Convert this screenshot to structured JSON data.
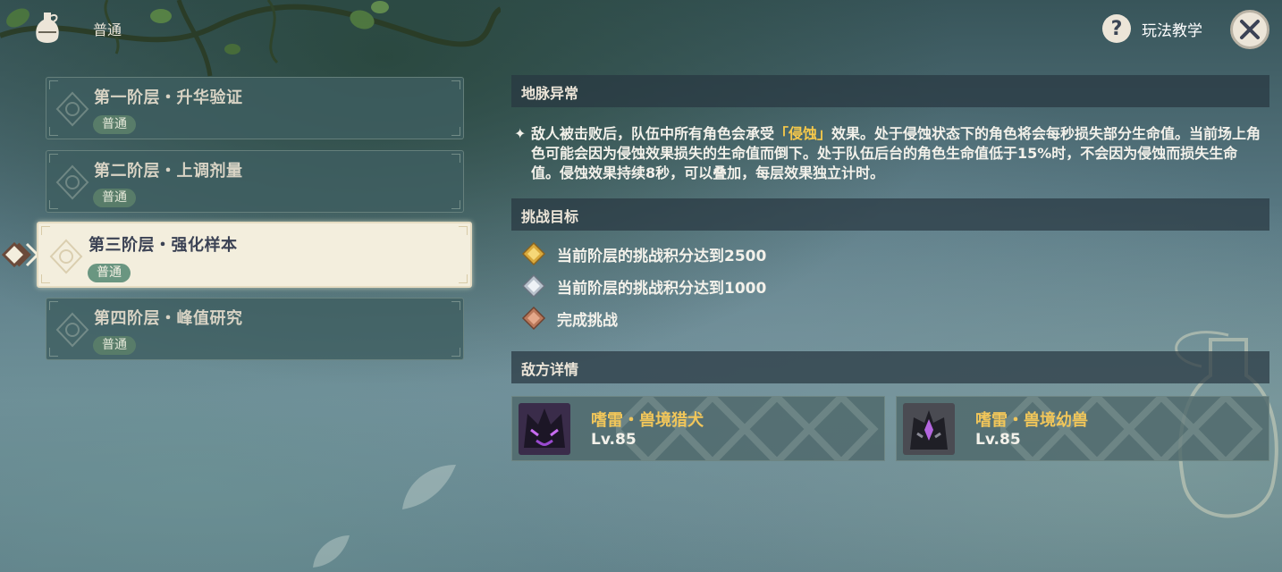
{
  "header": {
    "mode_label": "普通",
    "help_label": "玩法教学"
  },
  "stages": [
    {
      "title": "第一阶层・升华验证",
      "badge": "普通",
      "selected": false
    },
    {
      "title": "第二阶层・上调剂量",
      "badge": "普通",
      "selected": false
    },
    {
      "title": "第三阶层・强化样本",
      "badge": "普通",
      "selected": true
    },
    {
      "title": "第四阶层・峰值研究",
      "badge": "普通",
      "selected": false
    }
  ],
  "ley_line": {
    "header": "地脉异常",
    "star": "✦",
    "text_before": "敌人被击败后，队伍中所有角色会承受",
    "highlight": "「侵蚀」",
    "text_after": "效果。处于侵蚀状态下的角色将会每秒损失部分生命值。当前场上角色可能会因为侵蚀效果损失的生命值而倒下。处于队伍后台的角色生命值低于15%时，不会因为侵蚀而损失生命值。侵蚀效果持续8秒，可以叠加，每层效果独立计时。"
  },
  "challenge": {
    "header": "挑战目标",
    "goals": [
      {
        "icon": "gold-medal-icon",
        "text": "当前阶层的挑战积分达到2500"
      },
      {
        "icon": "silver-medal-icon",
        "text": "当前阶层的挑战积分达到1000"
      },
      {
        "icon": "bronze-medal-icon",
        "text": "完成挑战"
      }
    ]
  },
  "enemies": {
    "header": "敌方详情",
    "list": [
      {
        "name": "嗜雷・兽境猎犬",
        "level": "Lv.85",
        "portrait": "rifthound-portrait"
      },
      {
        "name": "嗜雷・兽境幼兽",
        "level": "Lv.85",
        "portrait": "rifthound-whelp-portrait"
      }
    ]
  },
  "colors": {
    "highlight": "#f7c94a",
    "enemy_name": "#f1c65a",
    "selected_card": "#f3eedd",
    "badge": "#6a9681"
  }
}
